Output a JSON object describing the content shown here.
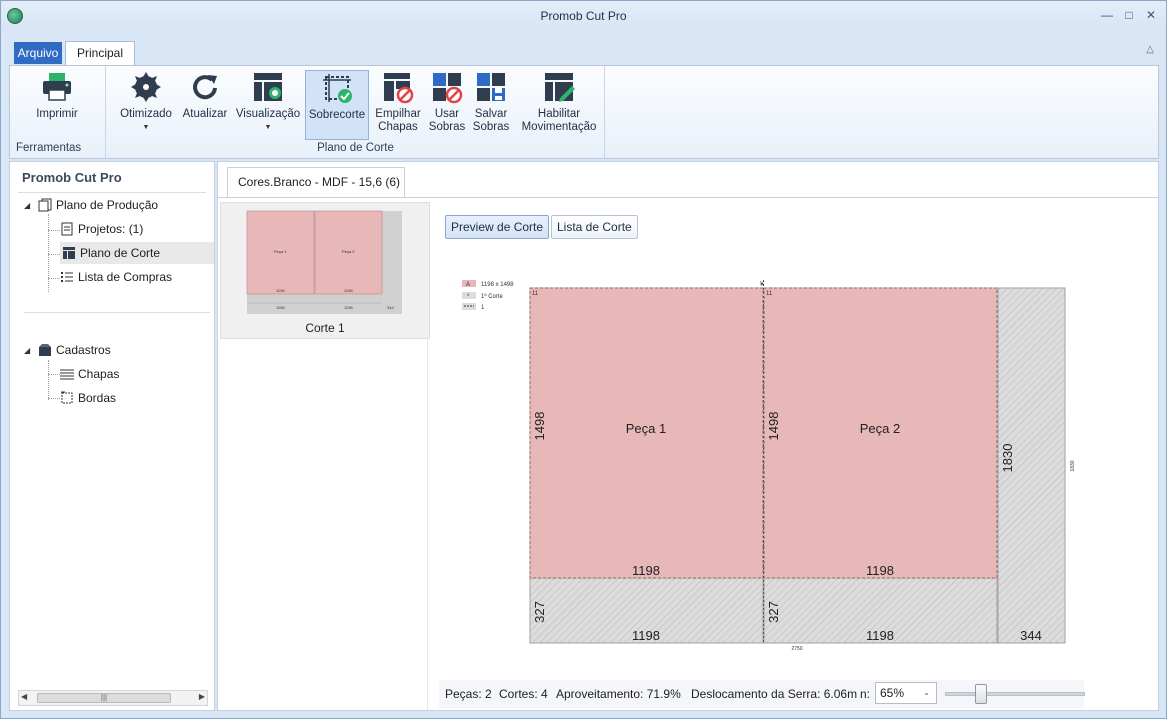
{
  "window": {
    "title": "Promob Cut Pro"
  },
  "window_controls": [
    "minimize-icon",
    "maximize-icon",
    "close-icon"
  ],
  "menu_tabs": [
    "Arquivo",
    "Principal"
  ],
  "ribbon": {
    "groups": [
      {
        "label": "Ferramentas",
        "buttons": [
          "Imprimir"
        ]
      },
      {
        "label": "Plano de Corte",
        "buttons": [
          "Otimizado",
          "Atualizar",
          "Visualização",
          "Sobrecorte",
          "Empilhar Chapas",
          "Usar Sobras",
          "Salvar Sobras",
          "Habilitar Movimentação"
        ]
      }
    ],
    "imprimir": "Imprimir",
    "otimizado": "Otimizado",
    "atualizar": "Atualizar",
    "visualizacao": "Visualização",
    "sobrecorte": "Sobrecorte",
    "empilhar_1": "Empilhar",
    "empilhar_2": "Chapas",
    "usar_1": "Usar",
    "usar_2": "Sobras",
    "salvar_1": "Salvar",
    "salvar_2": "Sobras",
    "habilitar_1": "Habilitar",
    "habilitar_2": "Movimentação",
    "group_ferramentas": "Ferramentas",
    "group_plano": "Plano de Corte"
  },
  "sidebar": {
    "title": "Promob Cut Pro",
    "plano_producao": "Plano de Produção",
    "projetos": "Projetos: (1)",
    "plano_corte": "Plano de Corte",
    "lista_compras": "Lista de Compras",
    "cadastros": "Cadastros",
    "chapas": "Chapas",
    "bordas": "Bordas"
  },
  "document_tab": "Cores.Branco - MDF - 15,6 (6)",
  "thumbnail": {
    "label": "Corte 1"
  },
  "viewer": {
    "preview_button": "Preview de Corte",
    "lista_button": "Lista de Corte"
  },
  "legend": {
    "item_a_tag": "A",
    "item_a": "1198 x 1498",
    "item_b": "1º Corte",
    "item_c": "1"
  },
  "sheet": {
    "total_width_label": "2750",
    "total_height_label": "1830",
    "side_height_label": "1830",
    "pieces": [
      {
        "name": "Peça 1",
        "width": "1198",
        "height": "1498",
        "corner": "11"
      },
      {
        "name": "Peça 2",
        "width": "1198",
        "height": "1498",
        "corner": "11"
      }
    ],
    "leftovers": [
      {
        "width": "1198",
        "height": "327"
      },
      {
        "width": "1198",
        "height": "327"
      },
      {
        "width": "344"
      }
    ]
  },
  "status": {
    "pecas": "Peças: 2",
    "cortes": "Cortes: 4",
    "aproveitamento": "Aproveitamento: 71.9%",
    "deslocamento": "Deslocamento da Serra: 6.06m",
    "zoom_suffix": "n:",
    "zoom": "65%"
  },
  "colors": {
    "accent": "#2f6bc4",
    "piece_fill": "#e8b7b7",
    "leftover": "#dcdcdc"
  }
}
